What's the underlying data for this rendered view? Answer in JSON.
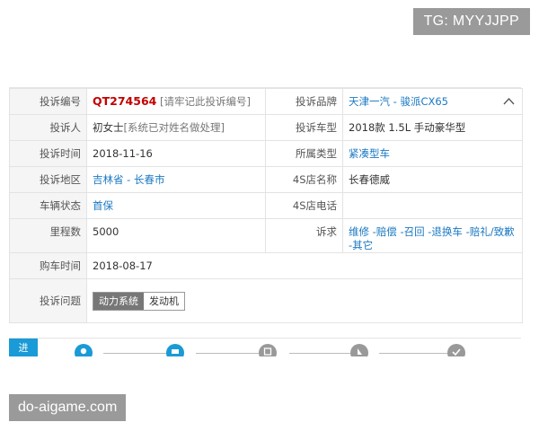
{
  "watermarks": {
    "top": "TG: MYYJJPP",
    "bottom": "do-aigame.com"
  },
  "complaint": {
    "id_label": "投诉编号",
    "id_value": "QT274564",
    "id_hint": "[请牢记此投诉编号]",
    "brand_label": "投诉品牌",
    "brand_value": "天津一汽 - 骏派CX65",
    "complainant_label": "投诉人",
    "complainant_value": "初女士",
    "complainant_note": "[系统已对姓名做处理]",
    "model_label": "投诉车型",
    "model_value": "2018款 1.5L 手动豪华型",
    "time_label": "投诉时间",
    "time_value": "2018-11-16",
    "type_label": "所属类型",
    "type_value": "紧凑型车",
    "region_label": "投诉地区",
    "region_value": "吉林省 - 长春市",
    "store_label": "4S店名称",
    "store_value": "长春德威",
    "status_label": "车辆状态",
    "status_value": "首保",
    "phone_label": "4S店电话",
    "phone_value": "",
    "mileage_label": "里程数",
    "mileage_value": "5000",
    "demand_label": "诉求",
    "demand_value": "维修 -赔偿 -召回 -退换车 -赔礼/致歉 -其它",
    "purchase_label": "购车时间",
    "purchase_value": "2018-08-17",
    "issue_label": "投诉问题",
    "issue_tags": [
      "动力系统",
      "发动机"
    ]
  },
  "steps": {
    "tab_label": "进",
    "colors": {
      "tab": "#1a9ad6",
      "done": "#1a9ad6",
      "pending": "#999999"
    }
  }
}
